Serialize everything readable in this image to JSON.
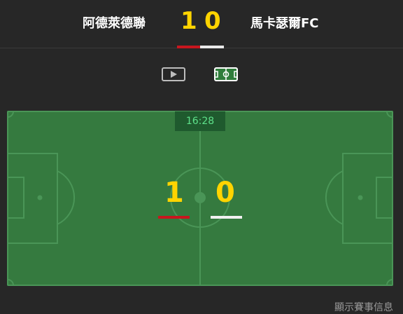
{
  "match": {
    "home_team": "阿德萊德聯",
    "away_team": "馬卡瑟爾FC",
    "home_score": "1",
    "away_score": "0"
  },
  "view_toggle": {
    "video_icon": "play-icon",
    "field_icon": "pitch-icon"
  },
  "pitch": {
    "clock": "16:28",
    "home_score": "1",
    "away_score": "0"
  },
  "footer": {
    "link_text": "顯示賽事信息"
  },
  "colors": {
    "background": "#272727",
    "score_yellow": "#ffd400",
    "home_red": "#c8161e",
    "away_white": "#e9e9e9",
    "pitch_green": "#357a3f",
    "clock_text": "#5ee08a"
  }
}
